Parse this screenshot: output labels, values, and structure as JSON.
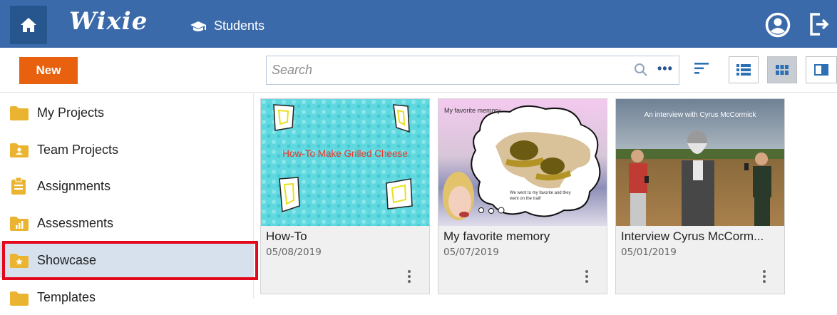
{
  "header": {
    "logo": "Wixie",
    "students_label": "Students"
  },
  "toolbar": {
    "new_label": "New",
    "search_placeholder": "Search",
    "more_label": "•••"
  },
  "sidebar": {
    "items": [
      {
        "label": "My Projects",
        "icon": "folder-icon"
      },
      {
        "label": "Team Projects",
        "icon": "team-folder-icon"
      },
      {
        "label": "Assignments",
        "icon": "clipboard-icon"
      },
      {
        "label": "Assessments",
        "icon": "assessment-icon"
      },
      {
        "label": "Showcase",
        "icon": "showcase-icon",
        "selected": true
      },
      {
        "label": "Templates",
        "icon": "folder-icon"
      }
    ]
  },
  "projects": [
    {
      "title": "How-To",
      "date": "05/08/2019",
      "thumb_text": "How-To Make Grilled Cheese"
    },
    {
      "title": "My favorite memory",
      "date": "05/07/2019",
      "thumb_text": "My favorite memory",
      "thumb_caption": "We went to my favorite and they went on the trail!"
    },
    {
      "title": "Interview Cyrus McCorm...",
      "date": "05/01/2019",
      "thumb_text": "An interview with Cyrus McCormick"
    }
  ],
  "colors": {
    "header": "#3a6aaa",
    "accent": "#e8610e",
    "folder": "#eab430",
    "highlight": "#e2091c"
  }
}
